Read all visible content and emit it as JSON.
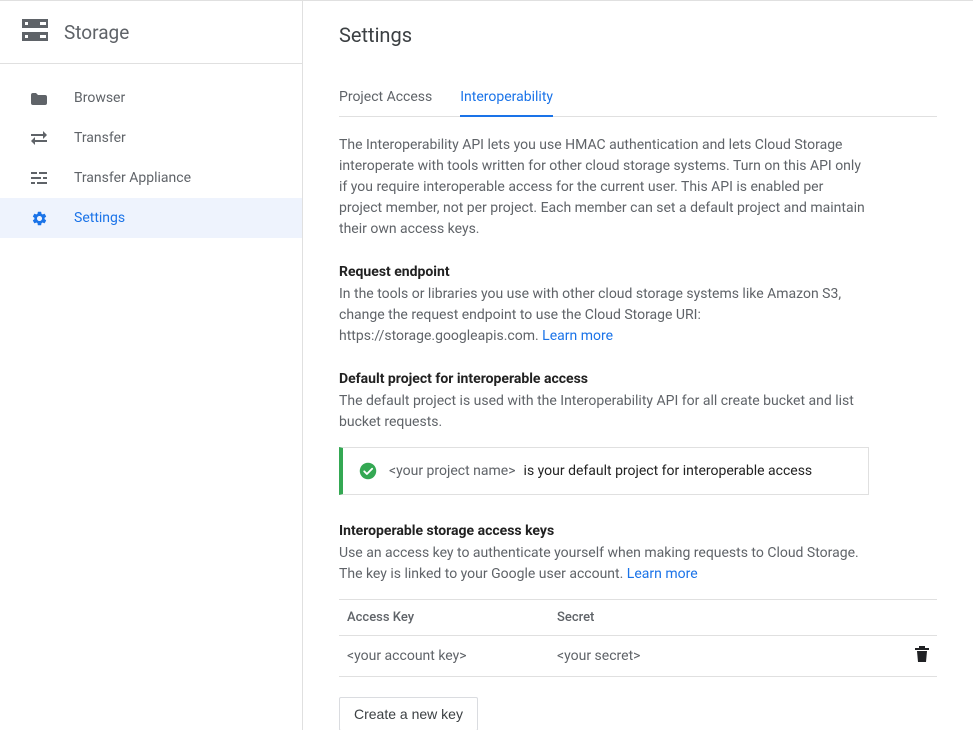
{
  "sidebar": {
    "title": "Storage",
    "items": [
      {
        "label": "Browser"
      },
      {
        "label": "Transfer"
      },
      {
        "label": "Transfer Appliance"
      },
      {
        "label": "Settings"
      }
    ]
  },
  "page": {
    "title": "Settings",
    "tabs": [
      {
        "label": "Project Access"
      },
      {
        "label": "Interoperability"
      }
    ],
    "intro": "The Interoperability API lets you use HMAC authentication and lets Cloud Storage interoperate with tools written for other cloud storage systems. Turn on this API only if you require interoperable access for the current user. This API is enabled per project member, not per project. Each member can set a default project and maintain their own access keys."
  },
  "endpoint": {
    "heading": "Request endpoint",
    "body_prefix": "In the tools or libraries you use with other cloud storage systems like Amazon S3, change the request endpoint to use the Cloud Storage URI: https://storage.googleapis.com. ",
    "learn_more": "Learn more"
  },
  "default_project": {
    "heading": "Default project for interoperable access",
    "body": "The default project is used with the Interoperability API for all create bucket and list bucket requests.",
    "callout_placeholder": "<your project name>",
    "callout_text": "is your default project for interoperable access"
  },
  "access_keys": {
    "heading": "Interoperable storage access keys",
    "body_prefix": "Use an access key to authenticate yourself when making requests to Cloud Storage. The key is linked to your Google user account. ",
    "learn_more": "Learn more",
    "columns": {
      "key": "Access Key",
      "secret": "Secret"
    },
    "rows": [
      {
        "key": "<your account key>",
        "secret": "<your secret>"
      }
    ],
    "create_button": "Create a new key"
  }
}
